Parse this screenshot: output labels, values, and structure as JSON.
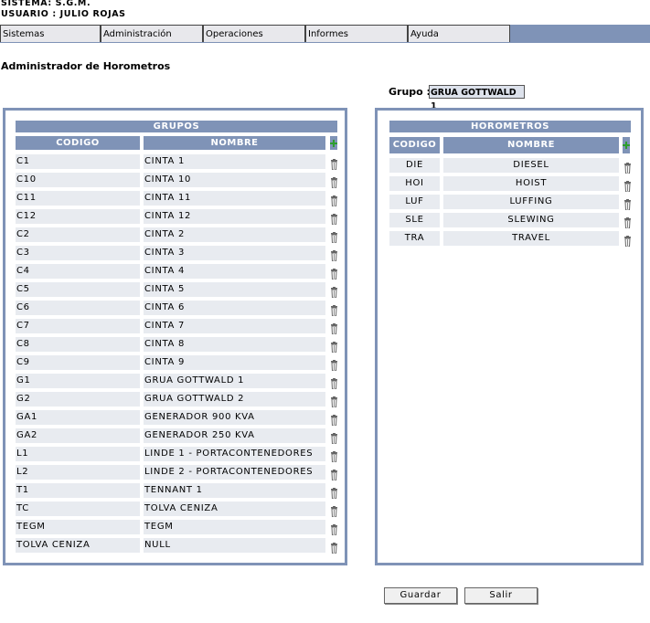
{
  "header": {
    "system": "SISTEMA: S.G.M.",
    "user": "USUARIO : JULIO ROJAS"
  },
  "menu": [
    "Sistemas",
    "Administración",
    "Operaciones",
    "Informes",
    "Ayuda"
  ],
  "page_title": "Administrador de Horometros",
  "grupo": {
    "label": "Grupo :",
    "value": "GRUA GOTTWALD 1"
  },
  "grupos": {
    "title": "GRUPOS",
    "columns": [
      "CODIGO",
      "NOMBRE"
    ],
    "rows": [
      [
        "C1",
        "CINTA 1"
      ],
      [
        "C10",
        "CINTA 10"
      ],
      [
        "C11",
        "CINTA 11"
      ],
      [
        "C12",
        "CINTA 12"
      ],
      [
        "C2",
        "CINTA 2"
      ],
      [
        "C3",
        "CINTA 3"
      ],
      [
        "C4",
        "CINTA 4"
      ],
      [
        "C5",
        "CINTA 5"
      ],
      [
        "C6",
        "CINTA 6"
      ],
      [
        "C7",
        "CINTA 7"
      ],
      [
        "C8",
        "CINTA 8"
      ],
      [
        "C9",
        "CINTA 9"
      ],
      [
        "G1",
        "GRUA GOTTWALD 1"
      ],
      [
        "G2",
        "GRUA GOTTWALD 2"
      ],
      [
        "GA1",
        "GENERADOR  900 KVA"
      ],
      [
        "GA2",
        "GENERADOR  250 KVA"
      ],
      [
        "L1",
        "LINDE 1 -  PORTACONTENEDORES"
      ],
      [
        "L2",
        "LINDE 2 - PORTACONTENEDORES"
      ],
      [
        "T1",
        "TENNANT 1"
      ],
      [
        "TC",
        "TOLVA CENIZA"
      ],
      [
        "TEGM",
        "TEGM"
      ],
      [
        "TOLVA  CENIZA",
        "NULL"
      ]
    ]
  },
  "horometros": {
    "title": "HOROMETROS",
    "columns": [
      "CODIGO",
      "NOMBRE"
    ],
    "rows": [
      [
        "DIE",
        "DIESEL"
      ],
      [
        "HOI",
        "HOIST"
      ],
      [
        "LUF",
        "LUFFING"
      ],
      [
        "SLE",
        "SLEWING"
      ],
      [
        "TRA",
        "TRAVEL"
      ]
    ]
  },
  "buttons": {
    "save": "Guardar",
    "exit": "Salir"
  },
  "colors": {
    "accent": "#7f93b7",
    "row_bg": "#e8ebf0",
    "add_icon": "#2e9e2e"
  }
}
